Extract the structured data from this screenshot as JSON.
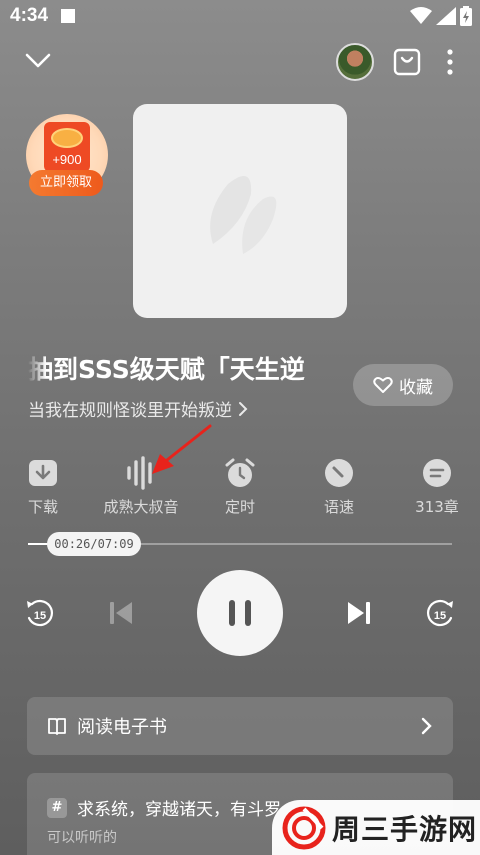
{
  "status_bar": {
    "time": "4:34"
  },
  "bonus": {
    "amount": "+900",
    "button_label": "立即领取"
  },
  "book": {
    "title": "抽到SSS级天赋「天生逆",
    "subtitle": "当我在规则怪谈里开始叛逆",
    "favorite_label": "收藏"
  },
  "actions": [
    {
      "icon": "download-icon",
      "label": "下载"
    },
    {
      "icon": "voice-wave-icon",
      "label": "成熟大叔音"
    },
    {
      "icon": "alarm-clock-icon",
      "label": "定时"
    },
    {
      "icon": "speed-gauge-icon",
      "label": "语速"
    },
    {
      "icon": "chapter-list-icon",
      "label": "313章"
    }
  ],
  "playback": {
    "time_display": "00:26/07:09",
    "progress_fraction": 0.06,
    "rewind_seconds": "15",
    "forward_seconds": "15"
  },
  "ebook": {
    "label": "阅读电子书"
  },
  "recommend": {
    "tag": "#",
    "title": "求系统，穿越诸天，有斗罗",
    "subtitle": "可以听听的"
  },
  "watermark": {
    "text": "周三手游网"
  },
  "colors": {
    "bonus_orange": "#ee5a1c",
    "annotation_arrow": "#e8231c"
  }
}
